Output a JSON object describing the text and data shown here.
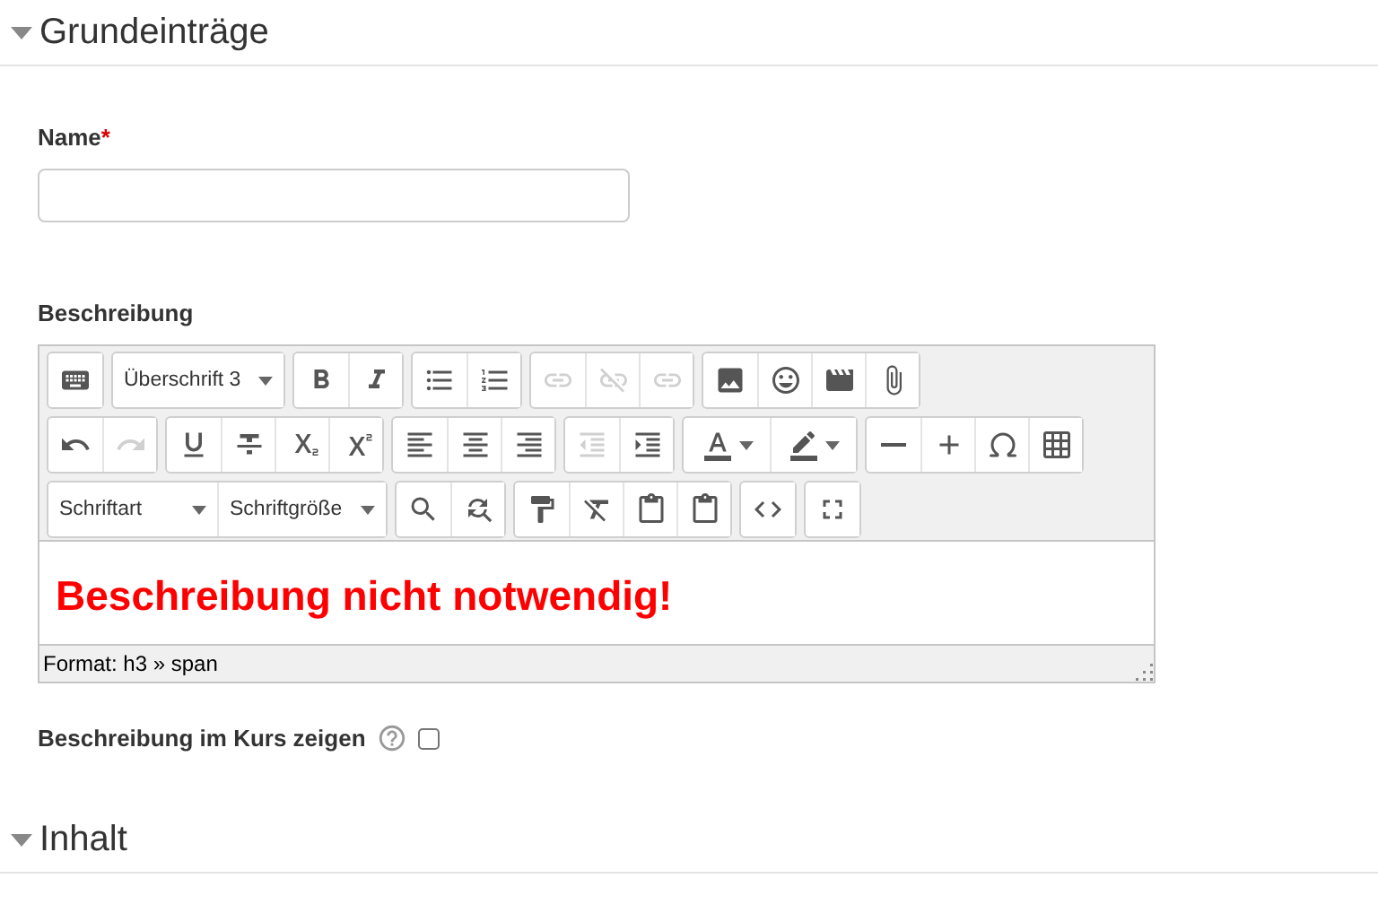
{
  "sections": [
    {
      "title": "Grundeinträge",
      "expanded": true
    },
    {
      "title": "Inhalt",
      "expanded": true
    }
  ],
  "name_field": {
    "label": "Name",
    "required_mark": "*"
  },
  "description": {
    "label": "Beschreibung",
    "toolbar": [
      [
        [
          {
            "kind": "button",
            "disabled": false
          }
        ],
        [
          {
            "kind": "select",
            "label": "Überschrift 3"
          }
        ],
        [
          {
            "kind": "button",
            "disabled": false
          },
          {
            "kind": "button",
            "disabled": false
          }
        ],
        [
          {
            "kind": "button",
            "disabled": false
          },
          {
            "kind": "button",
            "disabled": false
          }
        ],
        [
          {
            "kind": "button",
            "disabled": true
          },
          {
            "kind": "button",
            "disabled": true
          },
          {
            "kind": "button",
            "disabled": true
          }
        ],
        [
          {
            "kind": "button",
            "disabled": false
          },
          {
            "kind": "button",
            "disabled": false
          },
          {
            "kind": "button",
            "disabled": false
          },
          {
            "kind": "button",
            "disabled": false
          }
        ]
      ],
      [
        [
          {
            "kind": "button",
            "disabled": false
          },
          {
            "kind": "button",
            "disabled": true
          }
        ],
        [
          {
            "kind": "button",
            "disabled": false
          },
          {
            "kind": "button",
            "disabled": false
          },
          {
            "kind": "button",
            "disabled": false
          },
          {
            "kind": "button",
            "disabled": false
          }
        ],
        [
          {
            "kind": "button",
            "disabled": false
          },
          {
            "kind": "button",
            "disabled": false
          },
          {
            "kind": "button",
            "disabled": false
          }
        ],
        [
          {
            "kind": "button",
            "disabled": true
          },
          {
            "kind": "button",
            "disabled": false
          }
        ],
        [
          {
            "kind": "split",
            "disabled": false
          },
          {
            "kind": "split",
            "disabled": false
          }
        ],
        [
          {
            "kind": "button",
            "disabled": false
          },
          {
            "kind": "button",
            "disabled": false
          },
          {
            "kind": "button",
            "disabled": false
          },
          {
            "kind": "button",
            "disabled": false
          }
        ]
      ],
      [
        [
          {
            "kind": "select",
            "label": "Schriftart"
          },
          {
            "kind": "select",
            "label": "Schriftgröße"
          }
        ],
        [
          {
            "kind": "button",
            "disabled": false
          },
          {
            "kind": "button",
            "disabled": false
          }
        ],
        [
          {
            "kind": "button",
            "disabled": false
          },
          {
            "kind": "button",
            "disabled": false
          },
          {
            "kind": "button",
            "disabled": false
          },
          {
            "kind": "button",
            "disabled": false
          }
        ],
        [
          {
            "kind": "button",
            "disabled": false
          }
        ],
        [
          {
            "kind": "button",
            "disabled": false
          }
        ]
      ]
    ],
    "content": "Beschreibung nicht notwendig!",
    "status_path": "Format: h3 » span"
  },
  "show_in_course": {
    "label": "Beschreibung im Kurs zeigen",
    "checked": false
  }
}
